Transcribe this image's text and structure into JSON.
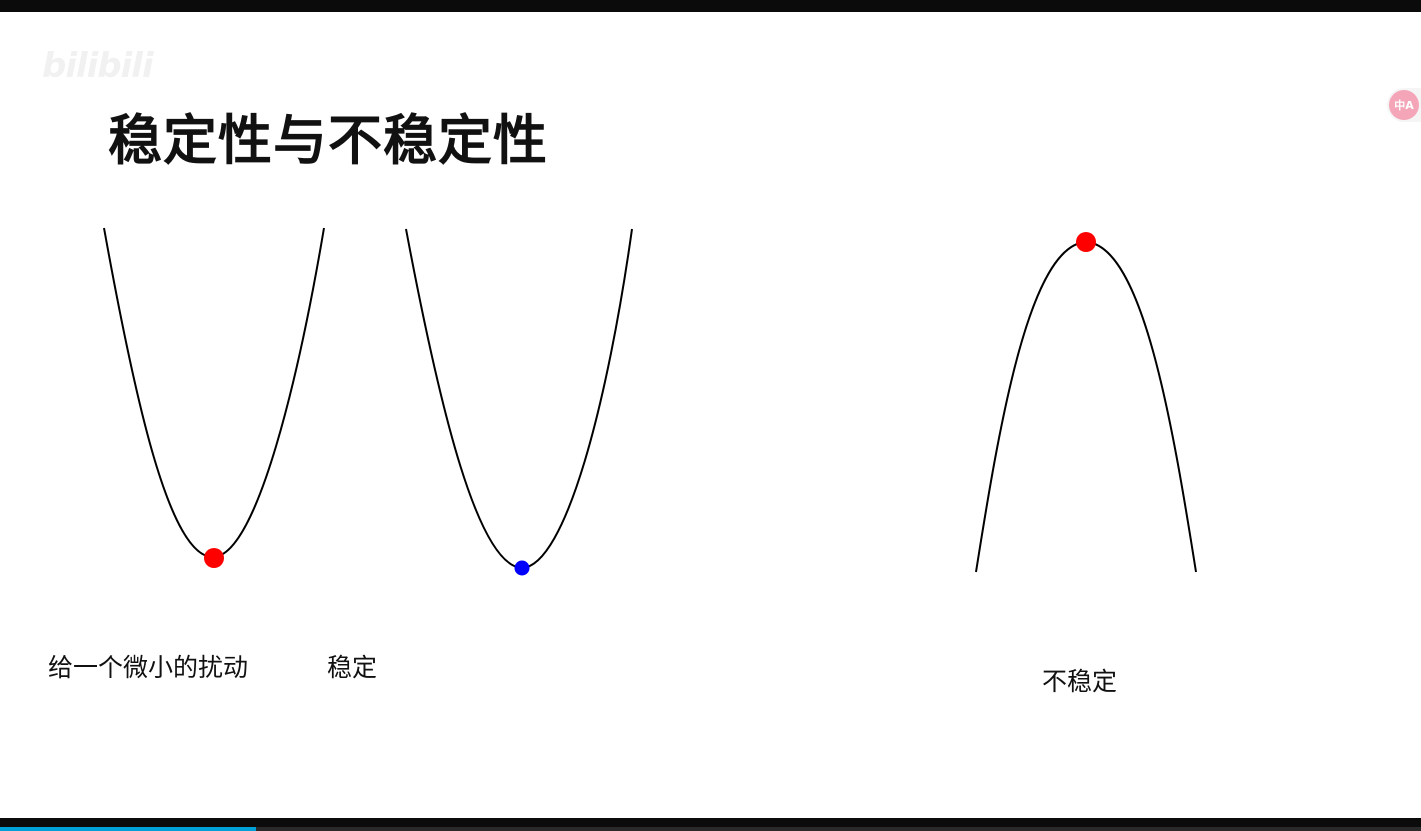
{
  "video": {
    "watermark_text": "",
    "watermark_logo": "bilibili",
    "translate_button_label": "中A",
    "progress_fraction": 0.18
  },
  "slide": {
    "title": "稳定性与不稳定性",
    "captions": {
      "perturbation": "给一个微小的扰动",
      "stable": "稳定",
      "unstable": "不稳定"
    },
    "colors": {
      "curve": "#000000",
      "ball_red": "#ff0000",
      "ball_blue": "#0000ff",
      "accent_progress": "#00a1d6"
    }
  }
}
